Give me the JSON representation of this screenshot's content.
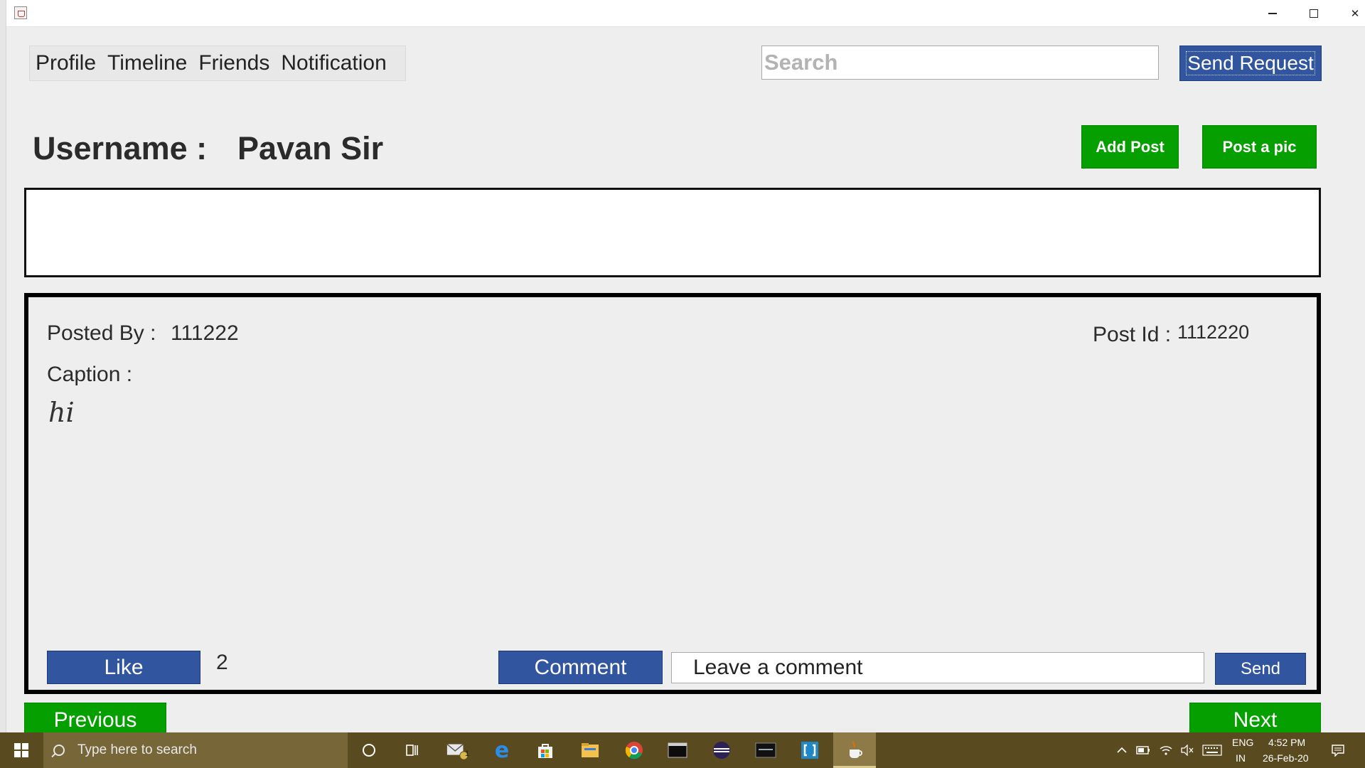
{
  "nav": {
    "items": [
      "Profile",
      "Timeline",
      "Friends",
      "Notification"
    ]
  },
  "search": {
    "placeholder": "Search"
  },
  "send_request_label": "Send Request",
  "user": {
    "username_label": "Username :",
    "username_value": "Pavan Sir"
  },
  "actions": {
    "add_post_label": "Add Post",
    "post_pic_label": "Post a pic"
  },
  "post": {
    "posted_by_label": "Posted By :",
    "posted_by_value": "111222",
    "post_id_label": "Post Id :",
    "post_id_value": "1112220",
    "caption_label": "Caption :",
    "caption_value": "hi",
    "like_label": "Like",
    "like_count": "2",
    "comment_label": "Comment",
    "comment_placeholder": "Leave a comment",
    "send_label": "Send"
  },
  "pager": {
    "previous_label": "Previous",
    "next_label": "Next"
  },
  "taskbar": {
    "search_placeholder": "Type here to search",
    "mail_badge": "1",
    "language_top": "ENG",
    "language_bottom": "IN",
    "time": "4:52 PM",
    "date": "26-Feb-20",
    "icons": [
      "windows-start-icon",
      "cortana-icon",
      "task-view-icon",
      "mail-icon",
      "edge-icon",
      "store-icon",
      "file-explorer-icon",
      "chrome-icon",
      "terminal-icon",
      "eclipse-icon",
      "mysql-icon",
      "bracket-app-icon",
      "java-app-icon"
    ]
  },
  "colors": {
    "window_bg": "#eeeeee",
    "blue_button": "#31559e",
    "green_button": "#05a000",
    "taskbar": "#5a4a20"
  }
}
